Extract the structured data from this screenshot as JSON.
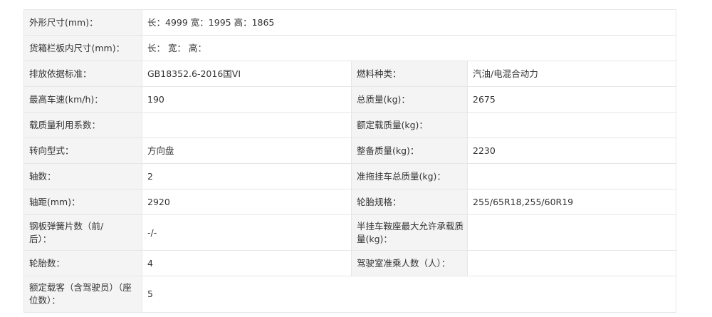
{
  "rows": [
    {
      "cells": [
        {
          "label": "外形尺寸(mm)：",
          "value": "长：4999 宽：1995 高：1865"
        }
      ]
    },
    {
      "cells": [
        {
          "label": "货箱栏板内尺寸(mm)：",
          "value": "长： 宽： 高："
        }
      ]
    },
    {
      "cells": [
        {
          "label": "排放依据标准：",
          "value": "GB18352.6-2016国VI"
        },
        {
          "label": "燃料种类：",
          "value": "汽油/电混合动力"
        }
      ]
    },
    {
      "cells": [
        {
          "label": "最高车速(km/h)：",
          "value": "190"
        },
        {
          "label": "总质量(kg)：",
          "value": "2675"
        }
      ]
    },
    {
      "cells": [
        {
          "label": "载质量利用系数：",
          "value": ""
        },
        {
          "label": "额定载质量(kg)：",
          "value": ""
        }
      ]
    },
    {
      "cells": [
        {
          "label": "转向型式：",
          "value": "方向盘"
        },
        {
          "label": "整备质量(kg)：",
          "value": "2230"
        }
      ]
    },
    {
      "cells": [
        {
          "label": "轴数：",
          "value": "2"
        },
        {
          "label": "准拖挂车总质量(kg)：",
          "value": ""
        }
      ]
    },
    {
      "cells": [
        {
          "label": "轴距(mm)：",
          "value": "2920"
        },
        {
          "label": "轮胎规格：",
          "value": "255/65R18,255/60R19"
        }
      ]
    },
    {
      "cells": [
        {
          "label": "钢板弹簧片数（前/后）：",
          "value": "-/-"
        },
        {
          "label": "半挂车鞍座最大允许承载质量(kg)：",
          "value": ""
        }
      ]
    },
    {
      "cells": [
        {
          "label": "轮胎数：",
          "value": "4"
        },
        {
          "label": "驾驶室准乘人数（人）：",
          "value": ""
        }
      ]
    },
    {
      "cells": [
        {
          "label": "额定载客（含驾驶员）（座位数）：",
          "value": "5"
        }
      ]
    }
  ]
}
